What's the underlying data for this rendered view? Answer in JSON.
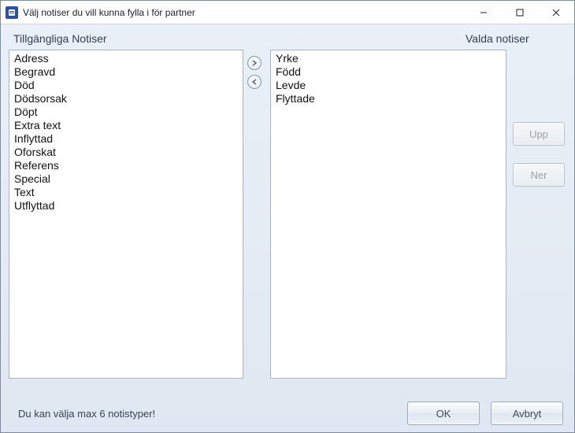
{
  "window": {
    "title": "Välj notiser du vill kunna fylla i för partner"
  },
  "headers": {
    "available": "Tillgängliga Notiser",
    "selected": "Valda notiser"
  },
  "available_items": [
    "Adress",
    "Begravd",
    "Död",
    "Dödsorsak",
    "Döpt",
    "Extra text",
    "Inflyttad",
    "Oforskat",
    "Referens",
    "Special",
    "Text",
    "Utflyttad"
  ],
  "selected_items": [
    "Yrke",
    "Född",
    "Levde",
    "Flyttade"
  ],
  "buttons": {
    "up": "Upp",
    "down": "Ner",
    "ok": "OK",
    "cancel": "Avbryt"
  },
  "footer_message": "Du kan välja max 6 notistyper!"
}
